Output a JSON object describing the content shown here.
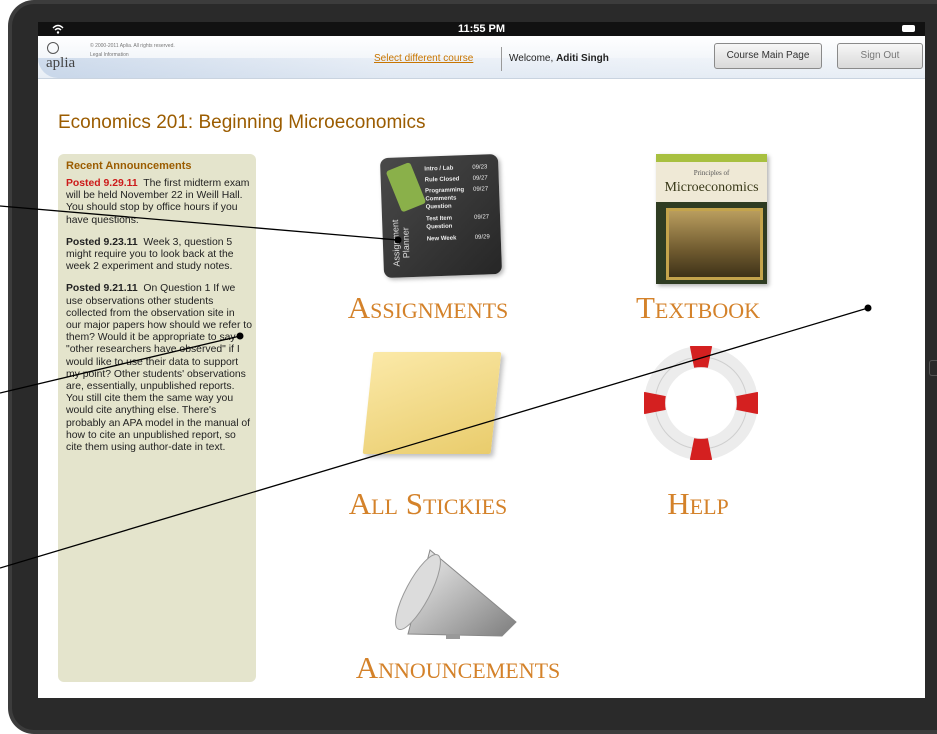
{
  "status": {
    "time": "11:55 PM"
  },
  "header": {
    "logo_text": "aplia",
    "copyright": "© 2000-2011 Aplia. All rights reserved.",
    "legal": "Legal Information",
    "select_course": "Select different course",
    "welcome_prefix": "Welcome,",
    "user_name": "Aditi Singh",
    "course_main_page": "Course Main Page",
    "sign_out": "Sign Out"
  },
  "course": {
    "title": "Economics 201: Beginning Microeconomics"
  },
  "announcements": {
    "heading": "Recent Announcements",
    "items": [
      {
        "date": "Posted 9.29.11",
        "text": "The first midterm exam will be held November 22 in Weill Hall. You should stop by office hours if you have questions."
      },
      {
        "date": "Posted 9.23.11",
        "text": "Week 3, question 5 might require you to look back at the week 2 experiment and study notes."
      },
      {
        "date": "Posted 9.21.11",
        "text": "On Question 1 If we use observations other students collected from the observation site in our major papers how should we refer to them? Would it be appropriate to say \"other researchers have observed\" if I would like to use their data to support my point? Other students' observations are, essentially, unpublished reports.  You still cite them the same way you would cite anything else.  There's probably an APA model in the manual of how to cite an unpublished report, so cite them using author-date in text."
      }
    ]
  },
  "tiles": {
    "assignments": "Assignments",
    "textbook": "Textbook",
    "stickies": "All Stickies",
    "help": "Help",
    "announcements": "Announcements"
  },
  "notebook": {
    "spine": "Assignment Planner",
    "rows": [
      {
        "name": "Intro / Lab",
        "date": "09/23"
      },
      {
        "name": "Rule Closed",
        "date": "09/27"
      },
      {
        "name": "Programming",
        "date": "09/27"
      },
      {
        "name": "Comments",
        "date": ""
      },
      {
        "name": "Question",
        "date": ""
      },
      {
        "name": "Test Item",
        "date": "09/27"
      },
      {
        "name": "Question",
        "date": ""
      },
      {
        "name": "New Week",
        "date": "09/29"
      }
    ]
  },
  "textbook_cover": {
    "title": "Microeconomics",
    "subtitle": "Principles of"
  },
  "colors": {
    "accent": "#d4822a",
    "title": "#9b5c00",
    "alert": "#cc1a1a",
    "panel": "#e4e4cc"
  }
}
